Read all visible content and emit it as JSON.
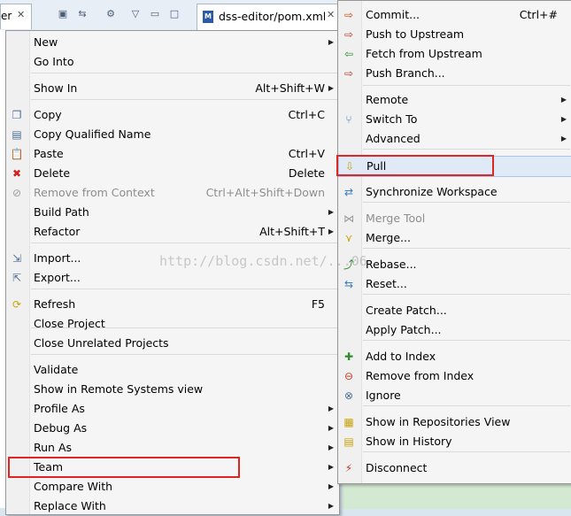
{
  "tabs": {
    "left_partial": "er",
    "editor_tab": "dss-editor/pom.xml",
    "close": "✕"
  },
  "watermark": "http://blog.csdn.net/...06",
  "context_menu": [
    {
      "label": "New",
      "arrow": true
    },
    {
      "label": "Go Into"
    },
    {
      "label": "Show In",
      "shortcut": "Alt+Shift+W",
      "arrow": true
    },
    {
      "label": "Copy",
      "shortcut": "Ctrl+C",
      "icon": "copy-icon"
    },
    {
      "label": "Copy Qualified Name",
      "icon": "copy-qualified-icon"
    },
    {
      "label": "Paste",
      "shortcut": "Ctrl+V",
      "icon": "paste-icon"
    },
    {
      "label": "Delete",
      "shortcut": "Delete",
      "icon": "delete-icon"
    },
    {
      "label": "Remove from Context",
      "shortcut": "Ctrl+Alt+Shift+Down",
      "disabled": true,
      "icon": "remove-context-icon"
    },
    {
      "label": "Build Path",
      "arrow": true
    },
    {
      "label": "Refactor",
      "shortcut": "Alt+Shift+T",
      "arrow": true
    },
    {
      "label": "Import...",
      "icon": "import-icon"
    },
    {
      "label": "Export...",
      "icon": "export-icon"
    },
    {
      "label": "Refresh",
      "shortcut": "F5",
      "icon": "refresh-icon"
    },
    {
      "label": "Close Project"
    },
    {
      "label": "Close Unrelated Projects"
    },
    {
      "label": "Validate"
    },
    {
      "label": "Show in Remote Systems view"
    },
    {
      "label": "Profile As",
      "arrow": true
    },
    {
      "label": "Debug As",
      "arrow": true
    },
    {
      "label": "Run As",
      "arrow": true
    },
    {
      "label": "Team",
      "arrow": true,
      "highlighted": true
    },
    {
      "label": "Compare With",
      "arrow": true
    },
    {
      "label": "Replace With",
      "arrow": true
    }
  ],
  "team_menu": [
    {
      "label": "Commit...",
      "shortcut": "Ctrl+#",
      "icon": "commit-icon"
    },
    {
      "label": "Push to Upstream",
      "icon": "push-upstream-icon"
    },
    {
      "label": "Fetch from Upstream",
      "icon": "fetch-upstream-icon"
    },
    {
      "label": "Push Branch...",
      "icon": "push-branch-icon"
    },
    {
      "label": "Remote",
      "arrow": true
    },
    {
      "label": "Switch To",
      "arrow": true,
      "icon": "switch-branch-icon"
    },
    {
      "label": "Advanced",
      "arrow": true
    },
    {
      "label": "Pull",
      "icon": "pull-icon",
      "highlighted": true
    },
    {
      "label": "Synchronize Workspace",
      "icon": "synchronize-icon"
    },
    {
      "label": "Merge Tool",
      "disabled": true,
      "icon": "merge-tool-icon"
    },
    {
      "label": "Merge...",
      "icon": "merge-icon"
    },
    {
      "label": "Rebase...",
      "icon": "rebase-icon"
    },
    {
      "label": "Reset...",
      "icon": "reset-icon"
    },
    {
      "label": "Create Patch..."
    },
    {
      "label": "Apply Patch..."
    },
    {
      "label": "Add to Index",
      "icon": "add-index-icon"
    },
    {
      "label": "Remove from Index",
      "icon": "remove-index-icon"
    },
    {
      "label": "Ignore",
      "icon": "ignore-icon"
    },
    {
      "label": "Show in Repositories View",
      "icon": "git-repositories-icon"
    },
    {
      "label": "Show in History",
      "icon": "history-icon"
    },
    {
      "label": "Disconnect",
      "icon": "disconnect-icon"
    }
  ],
  "colors": {
    "highlight_box": "#e02525",
    "menu_bg": "#f5f5f5"
  }
}
